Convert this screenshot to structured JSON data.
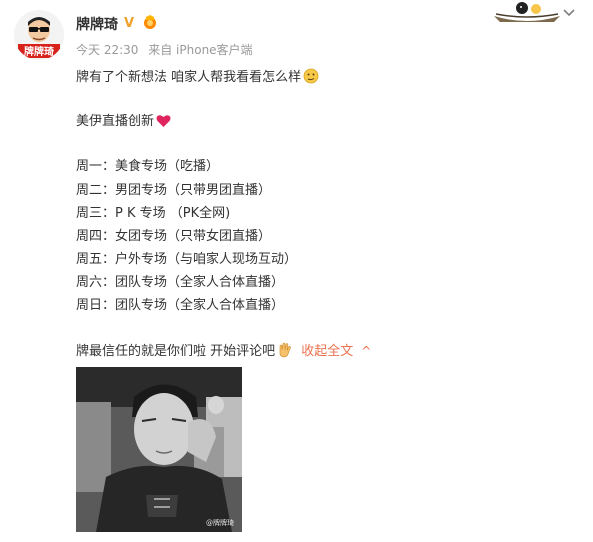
{
  "post": {
    "username": "牌牌琦",
    "verified_badge": "V",
    "time": "今天 22:30",
    "source": "来自 iPhone客户端",
    "avatar_text": "牌牌琦",
    "lines": [
      "牌有了个新想法 咱家人帮我看看怎么样",
      "美伊直播创新",
      "周一：美食专场（吃播）",
      "周二：男团专场（只带男团直播）",
      "周三：P K 专场 （PK全网)",
      "周四：女团专场（只带女团直播）",
      "周五：户外专场（与咱家人现场互动）",
      "周六：团队专场（全家人合体直播）",
      "周日：团队专场（全家人合体直播）",
      "牌最信任的就是你们啦 开始评论吧"
    ],
    "collapse_label": "收起全文",
    "collapse_caret": "^",
    "image_watermark": "@牌牌琦"
  },
  "icons": {
    "line1_emoji": "thinking-face-icon",
    "line2_emoji": "red-heart-icon",
    "line10_emoji": "vulcan-salute-hand-icon",
    "header_decoration": "boat-cartoon-icon",
    "menu": "chevron-down-icon"
  },
  "colors": {
    "accent": "#eb7350",
    "verified": "#f0a12b",
    "heart": "#e0245e"
  }
}
